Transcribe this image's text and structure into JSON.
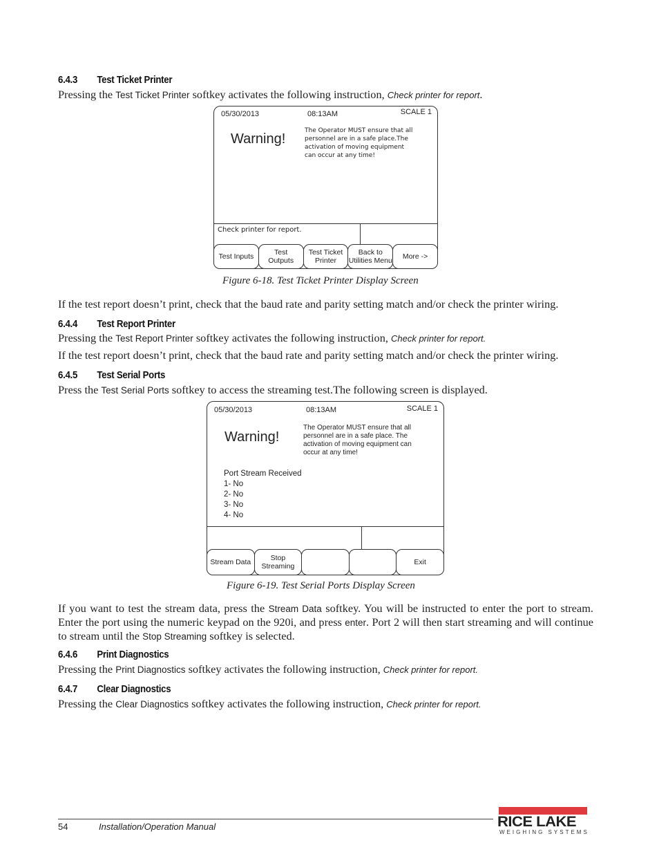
{
  "sections": [
    {
      "number": "6.4.3",
      "title": "Test Ticket Printer",
      "para1": {
        "pre": "Pressing the ",
        "softkey": "Test Ticket Printer",
        "mid": " softkey activates the following instruction, ",
        "instruction": "Check printer for report",
        "post": "."
      }
    },
    {
      "number": "6.4.4",
      "title": "Test Report Printer",
      "para1": {
        "pre": "Pressing the ",
        "softkey": "Test Report Printer",
        "mid": " softkey activates the following instruction, ",
        "instruction": "Check printer for report.",
        "post": ""
      },
      "para2": "If the test report doesn’t print, check that the baud rate and parity setting match and/or check the printer wiring."
    },
    {
      "number": "6.4.5",
      "title": "Test Serial Ports",
      "para1": {
        "pre": "Press the ",
        "softkey": "Test Serial Ports",
        "mid": " softkey to access the streaming test.The following screen is displayed.",
        "instruction": "",
        "post": ""
      }
    },
    {
      "number": "6.4.6",
      "title": "Print Diagnostics",
      "para1": {
        "pre": "Pressing the ",
        "softkey": "Print Diagnostics",
        "mid": " softkey activates the following instruction, ",
        "instruction": "Check printer for report.",
        "post": ""
      }
    },
    {
      "number": "6.4.7",
      "title": "Clear Diagnostics",
      "para1": {
        "pre": "Pressing the ",
        "softkey": "Clear Diagnostics",
        "mid": " softkey activates the following instruction, ",
        "instruction": "Check printer for report.",
        "post": ""
      }
    }
  ],
  "after_fig18": "If the test report doesn’t print, check that the baud rate and parity setting match and/or check the printer wiring.",
  "stream_para": {
    "t1": "If you want to test the stream data, press the ",
    "k1": "Stream Data",
    "t2": " softkey. You will be instructed to enter the port to stream. Enter the port using the numeric keypad on the 920i, and press ",
    "k2": "enter",
    "t3": ". Port 2 will then start streaming and will continue to stream until the ",
    "k3": "Stop Streaming",
    "t4": " softkey is selected."
  },
  "figure18": {
    "date": "05/30/2013",
    "time": "08:13AM",
    "scale": "SCALE 1",
    "warning": "Warning!",
    "message": "The Operator MUST ensure that all personnel are in a safe place.The activation of moving equipment can occur at any time!",
    "status": "Check printer for report.",
    "softkeys": [
      "Test Inputs",
      "Test\nOutputs",
      "Test Ticket\nPrinter",
      "Back to\nUtilities Menu",
      "More ->"
    ],
    "caption": "Figure 6-18. Test Ticket Printer Display Screen"
  },
  "figure19": {
    "date": "05/30/2013",
    "time": "08:13AM",
    "scale": "SCALE 1",
    "warning": "Warning!",
    "message": "The Operator MUST ensure that all personnel are in a safe place. The activation of moving equipment can occur at any time!",
    "port_header": "Port Stream  Received",
    "ports": [
      "1-  No",
      "2-  No",
      "3-  No",
      "4-  No"
    ],
    "softkeys": [
      "Stream Data",
      "Stop\nStreaming",
      "",
      "",
      "Exit"
    ],
    "caption": "Figure 6-19. Test Serial Ports Display Screen"
  },
  "footer": {
    "page_number": "54",
    "manual_title": "Installation/Operation Manual",
    "logo_text": "RICE LAKE",
    "logo_subtext": "WEIGHING SYSTEMS",
    "logo_color": "#e03a3e"
  }
}
